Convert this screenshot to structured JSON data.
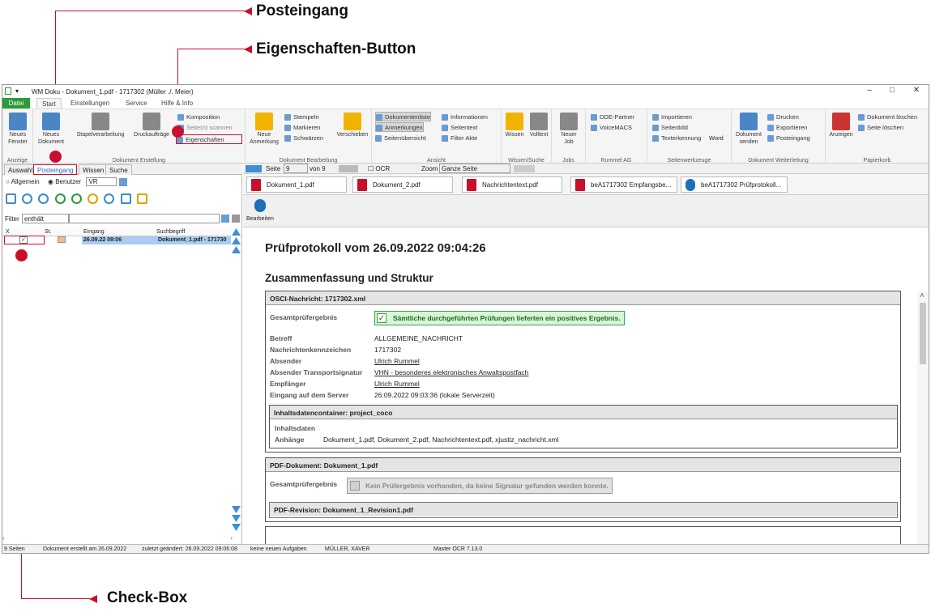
{
  "callouts": {
    "posteingang": "Posteingang",
    "eigenschaften": "Eigenschaften-Button",
    "checkbox": "Check-Box"
  },
  "colors": {
    "callout": "#c8102e",
    "file_tab": "#2e9a3a",
    "ok": "#176c23"
  },
  "window": {
    "title": "WM Doku - Dokument_1.pdf - 1717302 (Müller ./. Meier)",
    "controls": [
      "–",
      "□",
      "✕"
    ]
  },
  "menu_tabs": [
    "Datei",
    "Start",
    "Einstellungen",
    "Service",
    "Hilfe & Info"
  ],
  "ribbon": {
    "anzeige": {
      "label": "Anzeige",
      "neues_fenster": "Neues Fenster"
    },
    "erstellung": {
      "label": "Dokument Erstellung",
      "neues_dokument": "Neues Dokument",
      "stapel": "Stapelverarbeitung",
      "druck": "Druckaufträge",
      "komposition": "Komposition",
      "scannen": "Seite(n) scannen",
      "eigenschaften": "Eigenschaften"
    },
    "bearbeitung": {
      "label": "Dokument Bearbeitung",
      "neue_anmerkung": "Neue Anmerkung",
      "stempeln": "Stempeln",
      "markieren": "Markieren",
      "schwaerzen": "Schwärzen",
      "verschieben": "Verschieben"
    },
    "ansicht": {
      "label": "Ansicht",
      "dokumentenliste": "Dokumentenliste",
      "anmerkungen": "Anmerkungen",
      "seitenuebersicht": "Seitenübersicht",
      "informationen": "Informationen",
      "seitentext": "Seitentext",
      "filter_akte": "Filter Akte"
    },
    "wissen": {
      "label": "Wissen/Suche",
      "wissen": "Wissen",
      "volltext": "Volltext"
    },
    "jobs": {
      "label": "Jobs",
      "neuer_job": "Neuer Job"
    },
    "rummel": {
      "label": "Rummel AG",
      "dde": "DDE-Partner",
      "voicemacs": "VoiceMACS"
    },
    "seitenwerkzeuge": {
      "label": "Seitenwerkzeuge",
      "importieren": "Importieren",
      "seitenbild": "Seitenbild",
      "texterkennung": "Texterkennung",
      "word": "Word"
    },
    "weiterleitung": {
      "label": "Dokument Weiterleitung",
      "senden": "Dokument senden",
      "drucken": "Drucken",
      "exportieren": "Exportieren",
      "posteingang": "Posteingang"
    },
    "papierkorb": {
      "label": "Papierkorb",
      "anzeigen": "Anzeigen",
      "dok_loeschen": "Dokument löschen",
      "seite_loeschen": "Seite löschen"
    }
  },
  "left_tabs": [
    "Auswahl",
    "Posteingang",
    "Wissen",
    "Suche"
  ],
  "scope": {
    "allgemein": "Allgemein",
    "benutzer": "Benutzer",
    "user_value": "VR"
  },
  "filter": {
    "label": "Filter",
    "mode": "enthält",
    "value": ""
  },
  "grid": {
    "headers": [
      "X",
      "St.",
      "Eingang",
      "Suchbegriff"
    ],
    "rows": [
      {
        "checked": "✓",
        "date": "26.09.22 09:06",
        "term": "Dokument_1.pdf - 171730"
      }
    ]
  },
  "nav": {
    "seite_label": "Seite",
    "page": "9",
    "von": "von 9",
    "ocr": "OCR",
    "zoom_label": "Zoom",
    "zoom_value": "Ganze Seite"
  },
  "doc_tabs": [
    "Dokument_1.pdf",
    "Dokument_2.pdf",
    "Nachrichtentext.pdf",
    "beA1717302 Empfangsbe...",
    "beA1717302 Prüfprotokoll..."
  ],
  "edit_label": "Bearbeiten",
  "doc": {
    "title": "Prüfprotokoll vom 26.09.2022 09:04:26",
    "subtitle": "Zusammenfassung und Struktur",
    "osci": {
      "header": "OSCI-Nachricht: 1717302.xml",
      "ges_label": "Gesamtprüfergebnis",
      "ges_value": "Sämtliche durchgeführten Prüfungen lieferten ein positives Ergebnis.",
      "fields": [
        {
          "k": "Betreff",
          "v": "ALLGEMEINE_NACHRICHT"
        },
        {
          "k": "Nachrichtenkennzeichen",
          "v": "1717302"
        },
        {
          "k": "Absender",
          "v": "Ulrich Rummel"
        },
        {
          "k": "Absender Transportsignatur",
          "v": "VHN - besonderes elektronisches Anwaltspostfach"
        },
        {
          "k": "Empfänger",
          "v": "Ulrich Rummel"
        },
        {
          "k": "Eingang auf dem Server",
          "v": "26.09.2022 09:03:36 (lokale Serverzeit)"
        }
      ],
      "container": {
        "header": "Inhaltsdatencontainer: project_coco",
        "inhaltsdaten": "Inhaltsdaten",
        "anhaenge_label": "Anhänge",
        "anhaenge_value": "Dokument_1.pdf, Dokument_2.pdf, Nachrichtentext.pdf, xjustiz_nachricht.xml"
      }
    },
    "pdf": {
      "header": "PDF-Dokument: Dokument_1.pdf",
      "ges_label": "Gesamtprüfergebnis",
      "ges_value": "Kein Prüfergebnis vorhanden, da keine Signatur gefunden werden konnte.",
      "revision": "PDF-Revision: Dokument_1_Revision1.pdf"
    }
  },
  "status": {
    "pages": "9 Seiten",
    "created": "Dokument erstellt am 26.09.2022",
    "changed": "zuletzt geändert: 26.09.2022 09:06:08",
    "tasks": "keine neuen Aufgaben",
    "user": "MÜLLER, XAVER",
    "version": "Master OCR 7.13.0"
  }
}
